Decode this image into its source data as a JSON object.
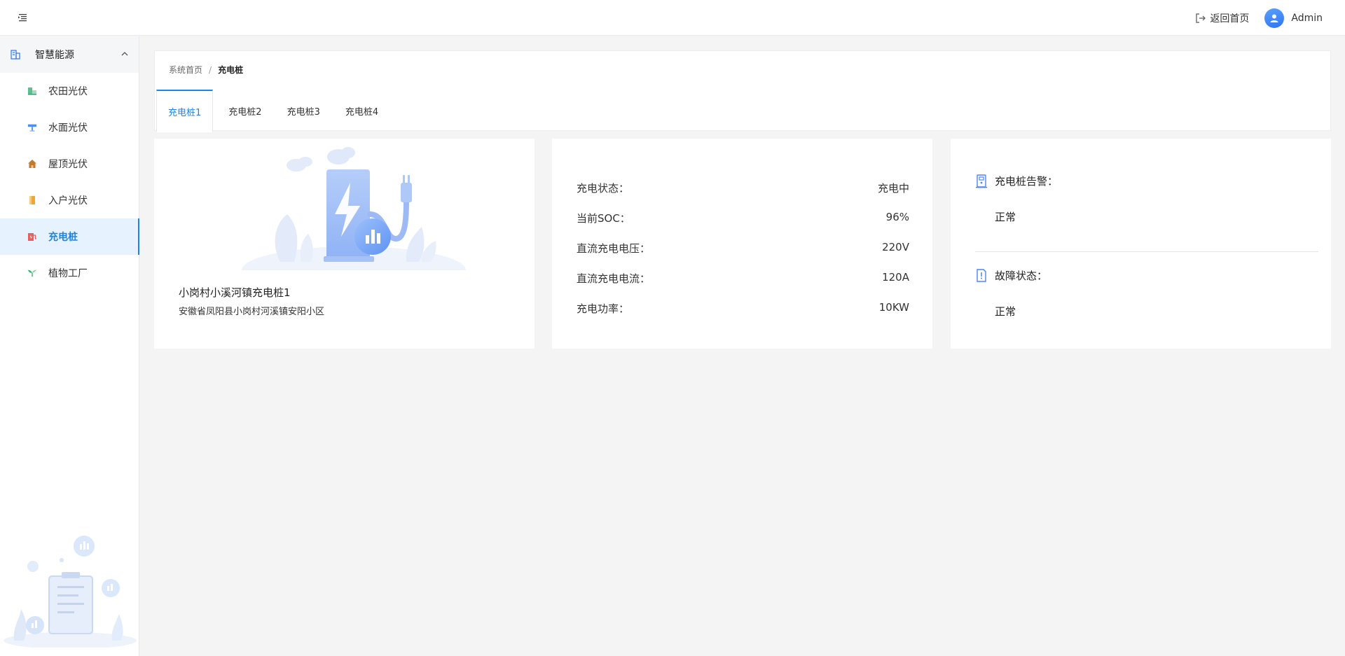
{
  "header": {
    "back_home_label": "返回首页",
    "user_name": "Admin",
    "accent_color": "#1a85e8"
  },
  "sidebar": {
    "group": {
      "label": "智慧能源",
      "icon": "building-icon",
      "expanded": true
    },
    "items": [
      {
        "label": "农田光伏",
        "icon": "farm-solar-icon",
        "active": false
      },
      {
        "label": "水面光伏",
        "icon": "water-solar-icon",
        "active": false
      },
      {
        "label": "屋顶光伏",
        "icon": "house-icon",
        "active": false
      },
      {
        "label": "入户光伏",
        "icon": "door-icon",
        "active": false
      },
      {
        "label": "充电桩",
        "icon": "charger-icon",
        "active": true
      },
      {
        "label": "植物工厂",
        "icon": "sprout-icon",
        "active": false
      }
    ]
  },
  "breadcrumb": {
    "home": "系统首页",
    "separator": "/",
    "current": "充电桩"
  },
  "tabs": [
    {
      "label": "充电桩1",
      "active": true
    },
    {
      "label": "充电桩2",
      "active": false
    },
    {
      "label": "充电桩3",
      "active": false
    },
    {
      "label": "充电桩4",
      "active": false
    }
  ],
  "station": {
    "name": "小岗村小溪河镇充电桩1",
    "address": "安徽省凤阳县小岗村河溪镇安阳小区"
  },
  "stats": [
    {
      "label": "充电状态：",
      "value": "充电中"
    },
    {
      "label": "当前SOC：",
      "value": "96%"
    },
    {
      "label": "直流充电电压：",
      "value": "220V"
    },
    {
      "label": "直流充电电流：",
      "value": "120A"
    },
    {
      "label": "充电功率：",
      "value": "10KW"
    }
  ],
  "alerts": {
    "alarm": {
      "title": "充电桩告警：",
      "value": "正常",
      "icon": "charger-alarm-icon"
    },
    "fault": {
      "title": "故障状态：",
      "value": "正常",
      "icon": "fault-doc-icon"
    }
  }
}
